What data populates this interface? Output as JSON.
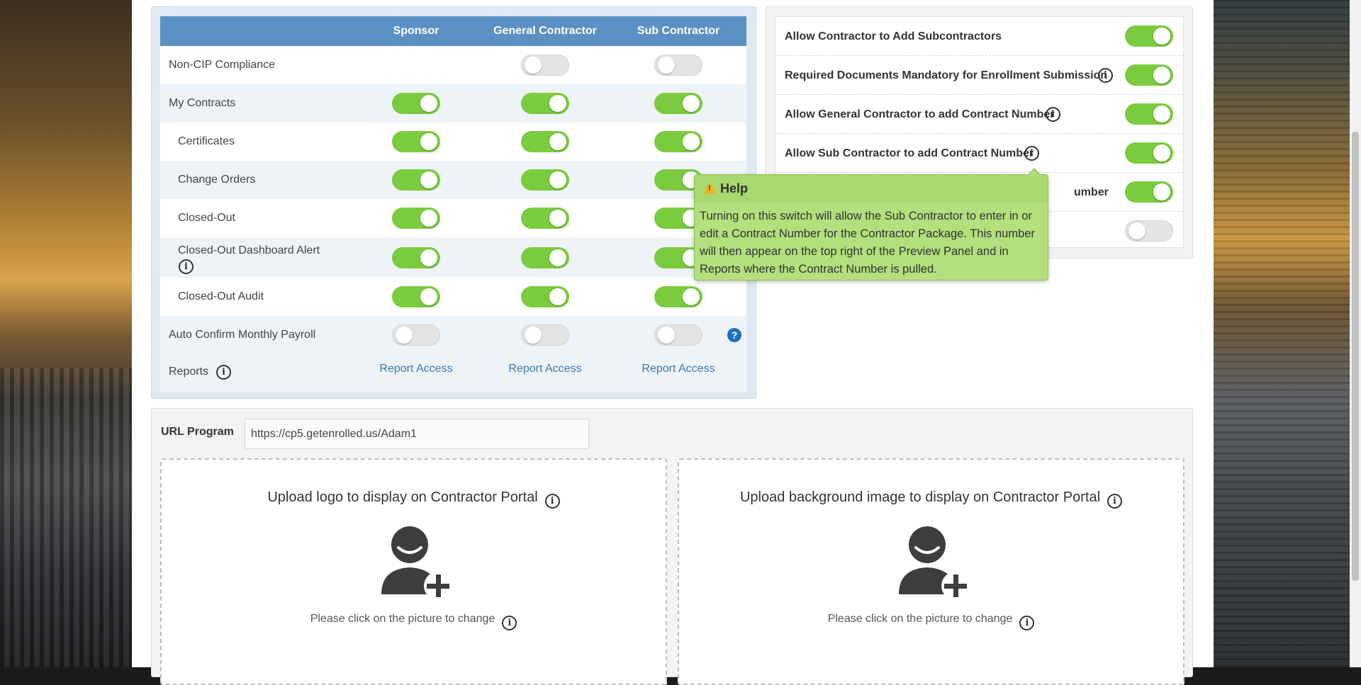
{
  "permissions": {
    "columns": [
      "Sponsor",
      "General Contractor",
      "Sub Contractor"
    ],
    "rows": [
      {
        "label": "Non-CIP Compliance",
        "indent": false,
        "sponsor": null,
        "gc": false,
        "sc": false
      },
      {
        "label": "My Contracts",
        "indent": false,
        "sponsor": true,
        "gc": true,
        "sc": true
      },
      {
        "label": "Certificates",
        "indent": true,
        "sponsor": true,
        "gc": true,
        "sc": true
      },
      {
        "label": "Change Orders",
        "indent": true,
        "sponsor": true,
        "gc": true,
        "sc": true
      },
      {
        "label": "Closed-Out",
        "indent": true,
        "sponsor": true,
        "gc": true,
        "sc": true
      },
      {
        "label": "Closed-Out Dashboard Alert",
        "indent": true,
        "sponsor": true,
        "gc": true,
        "sc": true
      },
      {
        "label": "Closed-Out Audit",
        "indent": true,
        "sponsor": true,
        "gc": true,
        "sc": true
      },
      {
        "label": "Auto Confirm Monthly Payroll",
        "indent": false,
        "sponsor": false,
        "gc": false,
        "sc": false
      }
    ],
    "reports": {
      "label": "Reports",
      "sponsor_link": "Report Access",
      "gc_link": "Report Access",
      "sc_link": "Report Access"
    },
    "help_glyph": "?"
  },
  "settings": {
    "items": [
      {
        "label": "Allow Contractor to Add Subcontractors",
        "on": true,
        "info": false
      },
      {
        "label": "Required Documents Mandatory for Enrollment Submission",
        "on": true,
        "info": true
      },
      {
        "label": "Allow General Contractor to add Contract Number",
        "on": true,
        "info": true
      },
      {
        "label": "Allow Sub Contractor to add Contract Number",
        "on": true,
        "info": true
      },
      {
        "label": "umber",
        "on": true,
        "info": false
      },
      {
        "label": "",
        "on": false,
        "info": false
      }
    ]
  },
  "tooltip": {
    "title": "Help",
    "warn_glyph": "!",
    "body": "Turning on this switch will allow the Sub Contractor to enter in or edit a Contract Number for the Contractor Package. This number will then appear on the top right of the Preview Panel and in Reports where the Contract Number is pulled."
  },
  "url_program": {
    "label": "URL Program",
    "value": "https://cp5.getenrolled.us/Adam1"
  },
  "uploads": [
    {
      "title": "Upload logo to display on Contractor Portal",
      "hint": "Please click on the picture to change"
    },
    {
      "title": "Upload background image to display on Contractor Portal",
      "hint": "Please click on the picture to change"
    }
  ],
  "info_glyph": "i",
  "colors": {
    "toggle_on": "#7acb3d",
    "toggle_off": "#e4e4e4",
    "table_header": "#5b90c4",
    "link": "#3a78b8",
    "tooltip_bg": "#b3df7d"
  }
}
